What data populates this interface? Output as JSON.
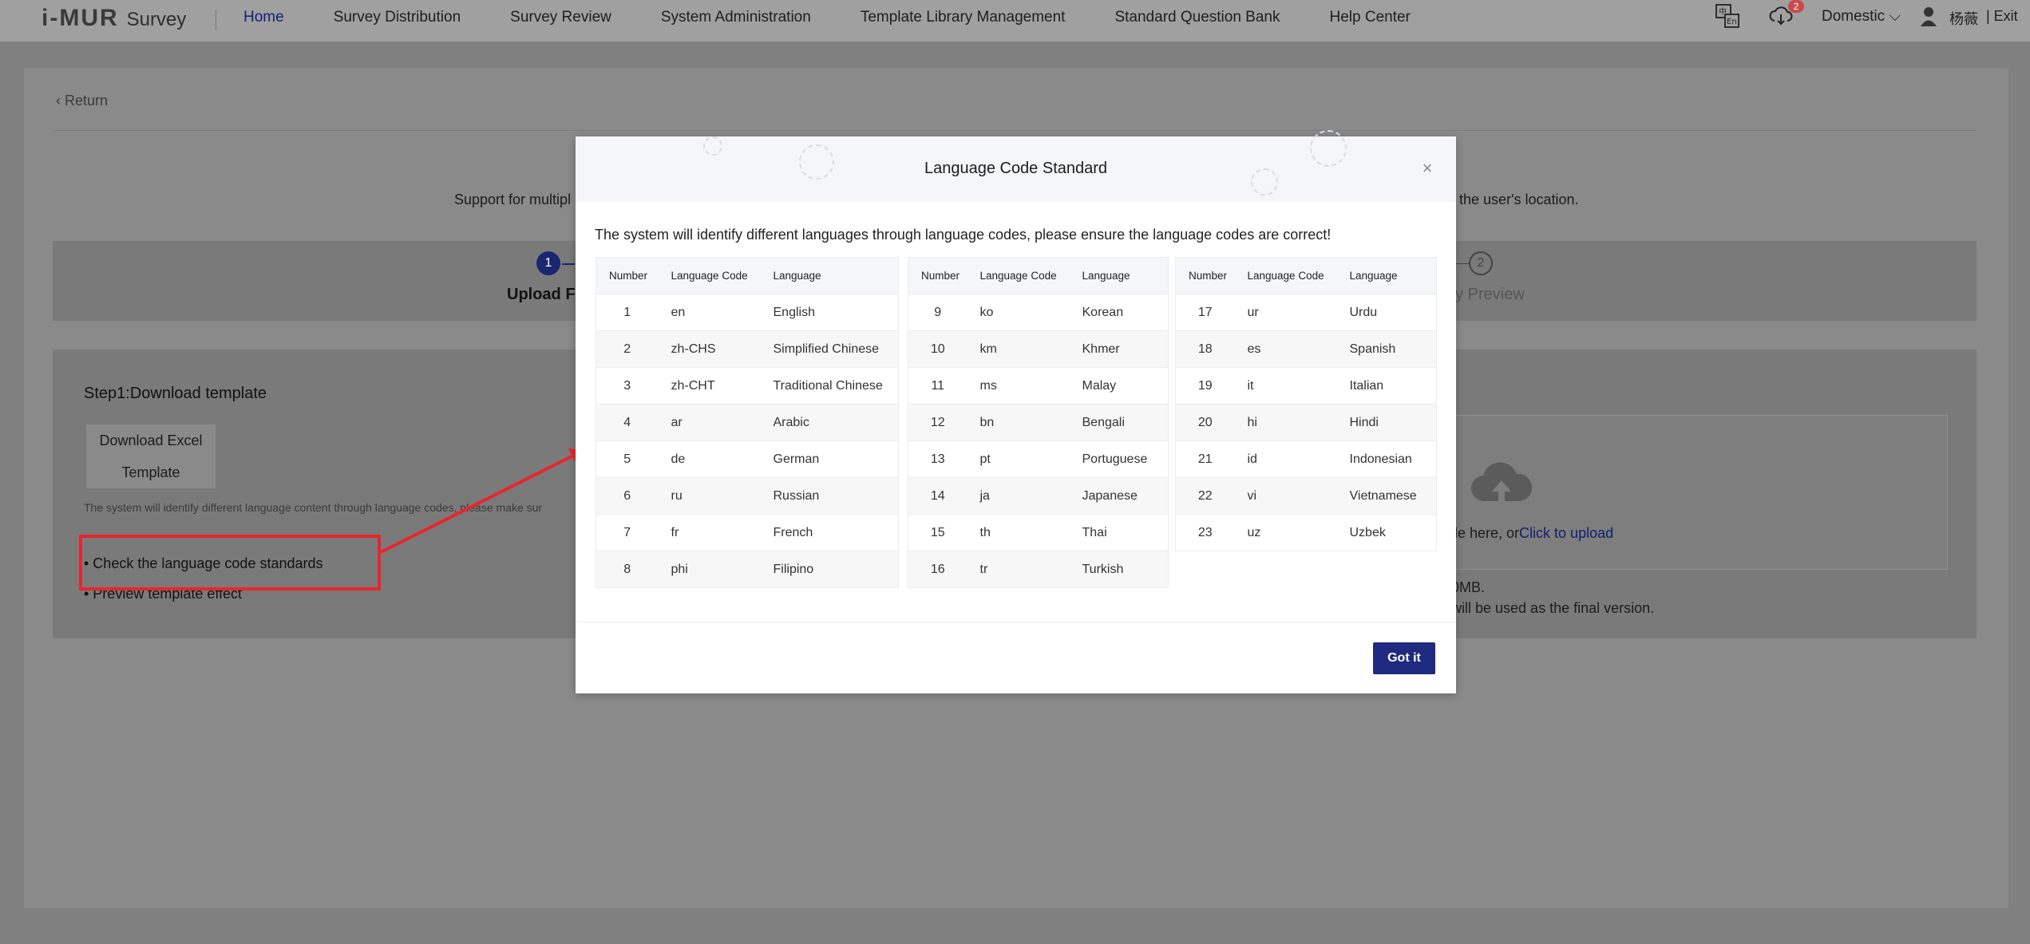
{
  "header": {
    "brand": "i-MUR",
    "app_name": "Survey",
    "nav": [
      "Home",
      "Survey Distribution",
      "Survey Review",
      "System Administration",
      "Template Library Management",
      "Standard Question Bank",
      "Help Center"
    ],
    "active_nav": "Home",
    "notification_count": "2",
    "region": "Domestic",
    "user_name": "杨薇",
    "exit_label": "| Exit",
    "language_icon": "translate-icon"
  },
  "page": {
    "return_label": "Return",
    "support_text": "Support for multipl",
    "support_text_right": "the user's location.",
    "step1_number": "1",
    "step1_label": "Upload F",
    "step2_number": "2",
    "step2_label": "vey Preview",
    "step1_title": "Step1:Download template",
    "download_btn_line1": "Download Excel",
    "download_btn_line2": "Template",
    "hint_text": "The system will identify different language content through language codes, please make sur",
    "link_check": "• Check the language code standards",
    "link_preview": "• Preview template effect",
    "upload_text_prefix": "ile here, or",
    "upload_link": "Click to upload",
    "size_text": "0MB.",
    "final_text": "will be used as the final version."
  },
  "modal": {
    "title": "Language Code Standard",
    "description": "The system will identify different languages through language codes, please ensure the language codes are correct!",
    "headers": [
      "Number",
      "Language Code",
      "Language"
    ],
    "tables": [
      [
        [
          "1",
          "en",
          "English"
        ],
        [
          "2",
          "zh-CHS",
          "Simplified Chinese"
        ],
        [
          "3",
          "zh-CHT",
          "Traditional Chinese"
        ],
        [
          "4",
          "ar",
          "Arabic"
        ],
        [
          "5",
          "de",
          "German"
        ],
        [
          "6",
          "ru",
          "Russian"
        ],
        [
          "7",
          "fr",
          "French"
        ],
        [
          "8",
          "phi",
          "Filipino"
        ]
      ],
      [
        [
          "9",
          "ko",
          "Korean"
        ],
        [
          "10",
          "km",
          "Khmer"
        ],
        [
          "11",
          "ms",
          "Malay"
        ],
        [
          "12",
          "bn",
          "Bengali"
        ],
        [
          "13",
          "pt",
          "Portuguese"
        ],
        [
          "14",
          "ja",
          "Japanese"
        ],
        [
          "15",
          "th",
          "Thai"
        ],
        [
          "16",
          "tr",
          "Turkish"
        ]
      ],
      [
        [
          "17",
          "ur",
          "Urdu"
        ],
        [
          "18",
          "es",
          "Spanish"
        ],
        [
          "19",
          "it",
          "Italian"
        ],
        [
          "20",
          "hi",
          "Hindi"
        ],
        [
          "21",
          "id",
          "Indonesian"
        ],
        [
          "22",
          "vi",
          "Vietnamese"
        ],
        [
          "23",
          "uz",
          "Uzbek"
        ]
      ]
    ],
    "confirm_label": "Got it"
  },
  "colors": {
    "accent": "#1f2a80",
    "annotation": "#e8262d",
    "overlay": "#808080"
  }
}
